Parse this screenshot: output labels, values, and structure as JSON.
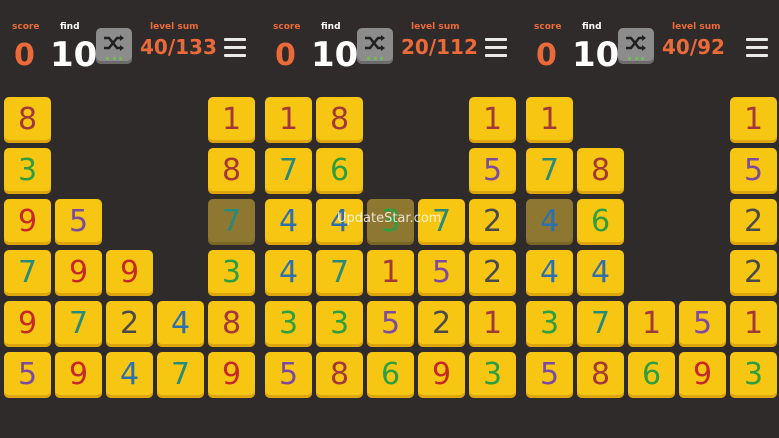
{
  "colors": {
    "background": "#2f2b2b",
    "accent_orange": "#ea6a3a",
    "tile": "#f7c612",
    "tile_selected": "#8e7730",
    "digit_colors": {
      "1": "#a33838",
      "2": "#4a4a4a",
      "3": "#2e9e40",
      "4": "#2e6fb0",
      "5": "#7d4b9e",
      "6": "#2e9e40",
      "7": "#2a8a7a",
      "8": "#a33838",
      "9": "#c62828"
    }
  },
  "icons": {
    "shuffle": "shuffle-icon",
    "menu": "hamburger-menu-icon"
  },
  "panels": [
    {
      "labels": {
        "score": "score",
        "find": "find",
        "level_sum": "level sum"
      },
      "score": "0",
      "find": "10",
      "level_sum": "40/133",
      "columns": [
        [
          "8",
          "3",
          "9",
          "7",
          "9",
          "5"
        ],
        [
          "",
          "",
          "5",
          "9",
          "7",
          "9"
        ],
        [
          "",
          "",
          "",
          "9",
          "2",
          "4"
        ],
        [
          "",
          "",
          "",
          "",
          "4",
          "7"
        ],
        [
          "1",
          "8",
          "7",
          "3",
          "8",
          "9"
        ]
      ],
      "selected": [
        [
          4,
          2
        ]
      ]
    },
    {
      "labels": {
        "score": "score",
        "find": "find",
        "level_sum": "level sum"
      },
      "score": "0",
      "find": "10",
      "level_sum": "20/112",
      "columns": [
        [
          "1",
          "7",
          "4",
          "4",
          "3",
          "5"
        ],
        [
          "8",
          "6",
          "4",
          "7",
          "3",
          "8"
        ],
        [
          "",
          "",
          "3",
          "1",
          "5",
          "6"
        ],
        [
          "",
          "",
          "7",
          "5",
          "2",
          "9"
        ],
        [
          "1",
          "5",
          "2",
          "2",
          "1",
          "3"
        ]
      ],
      "selected": [
        [
          2,
          2
        ]
      ]
    },
    {
      "labels": {
        "score": "score",
        "find": "find",
        "level_sum": "level sum"
      },
      "score": "0",
      "find": "10",
      "level_sum": "40/92",
      "columns": [
        [
          "1",
          "7",
          "4",
          "4",
          "3",
          "5"
        ],
        [
          "",
          "8",
          "6",
          "4",
          "7",
          "8"
        ],
        [
          "",
          "",
          "",
          "",
          "1",
          "6"
        ],
        [
          "",
          "",
          "",
          "",
          "5",
          "9"
        ],
        [
          "1",
          "5",
          "2",
          "2",
          "1",
          "3"
        ]
      ],
      "selected": [
        [
          0,
          2
        ]
      ]
    }
  ],
  "watermark": "UpdateStar.com"
}
